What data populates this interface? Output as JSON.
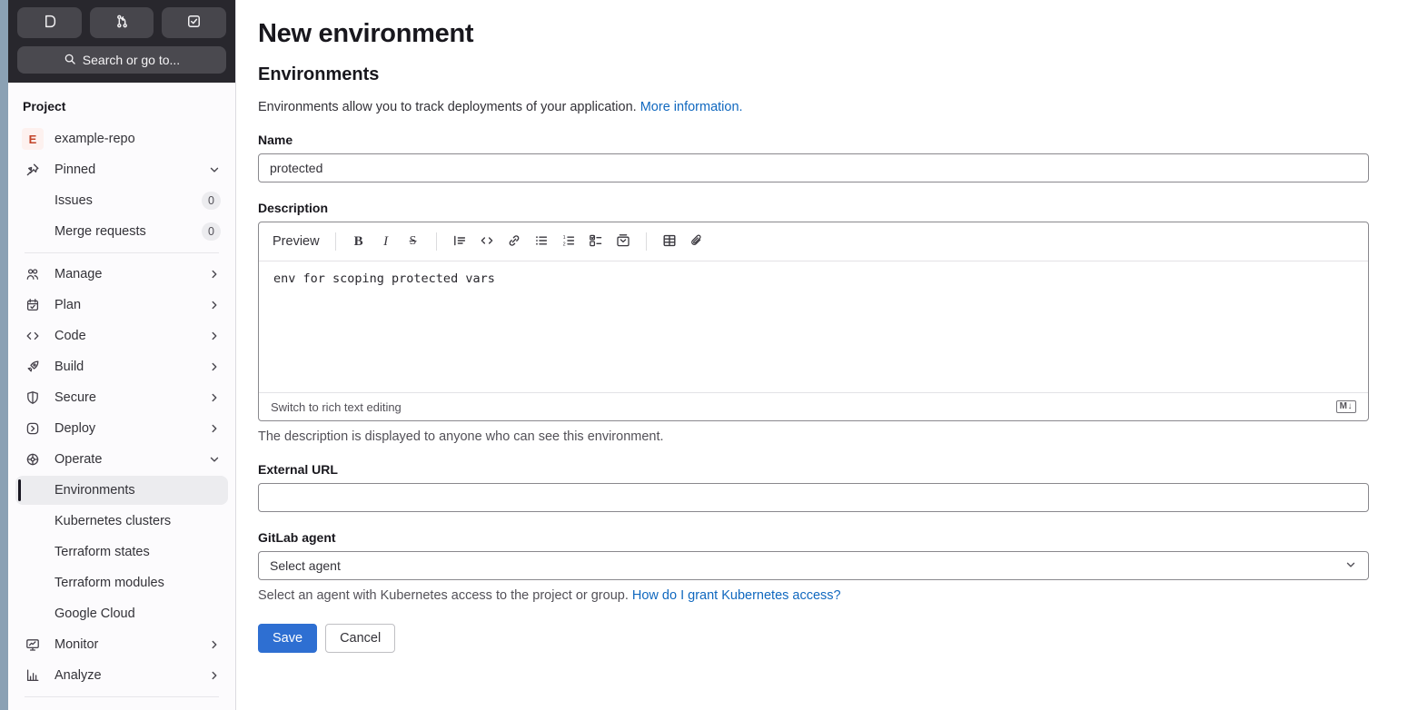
{
  "colors": {
    "accent_blue": "#2e6fd2",
    "link_blue": "#1068bf",
    "sidebar_header_bg": "#28272d",
    "active_item_bg": "#ececef",
    "avatar_bg": "#fdf1ef",
    "avatar_text": "#c24328",
    "edge_strip": "#8ba1b4"
  },
  "sidebar": {
    "search_label": "Search or go to...",
    "section_label": "Project",
    "project_avatar_letter": "E",
    "project_name": "example-repo",
    "pinned_label": "Pinned",
    "pinned_items": [
      {
        "label": "Issues",
        "count": "0"
      },
      {
        "label": "Merge requests",
        "count": "0"
      }
    ],
    "menu_items": [
      {
        "label": "Manage"
      },
      {
        "label": "Plan"
      },
      {
        "label": "Code"
      },
      {
        "label": "Build"
      },
      {
        "label": "Secure"
      },
      {
        "label": "Deploy"
      }
    ],
    "operate_label": "Operate",
    "operate_children": [
      {
        "label": "Environments"
      },
      {
        "label": "Kubernetes clusters"
      },
      {
        "label": "Terraform states"
      },
      {
        "label": "Terraform modules"
      },
      {
        "label": "Google Cloud"
      }
    ],
    "footer_items": [
      {
        "label": "Monitor"
      },
      {
        "label": "Analyze"
      }
    ]
  },
  "main": {
    "title": "New environment",
    "section_title": "Environments",
    "intro_text": "Environments allow you to track deployments of your application.",
    "intro_link": "More information.",
    "name_label": "Name",
    "name_value": "protected",
    "description_label": "Description",
    "editor": {
      "preview_label": "Preview",
      "content": "env for scoping protected vars",
      "switch_label": "Switch to rich text editing",
      "markdown_badge": "M↓"
    },
    "description_help": "The description is displayed to anyone who can see this environment.",
    "external_url_label": "External URL",
    "external_url_value": "",
    "agent_label": "GitLab agent",
    "agent_placeholder": "Select agent",
    "agent_help": "Select an agent with Kubernetes access to the project or group.",
    "agent_help_link": "How do I grant Kubernetes access?",
    "save_label": "Save",
    "cancel_label": "Cancel"
  }
}
